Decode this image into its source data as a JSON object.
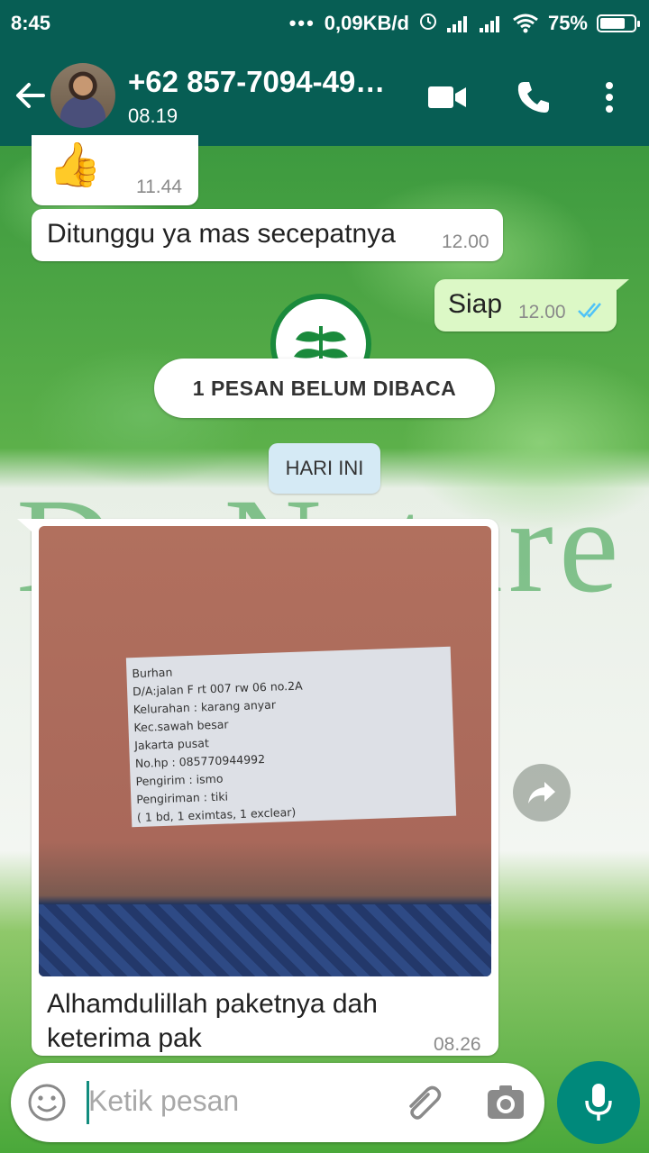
{
  "status_bar": {
    "time": "8:45",
    "dots": "•••",
    "network_speed": "0,09KB/d",
    "battery_percent": "75%",
    "battery_level": 0.75
  },
  "header": {
    "contact_name": "+62 857-7094-49…",
    "subtitle": "08.19"
  },
  "messages": [
    {
      "id": "thumbs",
      "direction": "in",
      "content": "👍",
      "time": "11.44"
    },
    {
      "id": "m1",
      "direction": "in",
      "text": "Ditunggu ya mas secepatnya",
      "time": "12.00"
    },
    {
      "id": "m2",
      "direction": "out",
      "text": "Siap",
      "time": "12.00",
      "status": "read"
    }
  ],
  "unread_banner": "1 PESAN BELUM DIBACA",
  "date_chip": "HARI INI",
  "photo_message": {
    "label_lines": [
      "Burhan",
      "D/A:jalan F rt 007 rw 06 no.2A",
      "Kelurahan : karang anyar",
      "Kec.sawah besar",
      "Jakarta pusat",
      "No.hp : 085770944992",
      "Pengirim : ismo",
      "Pengiriman : tiki",
      "( 1 bd, 1 eximtas, 1 exclear)"
    ],
    "caption_line1": "Alhamdulillah paketnya dah",
    "caption_line2": "keterima pak",
    "time": "08.26"
  },
  "background_text": "De Nature",
  "input": {
    "placeholder": "Ketik pesan"
  },
  "colors": {
    "header": "#075e54",
    "outgoing_bubble": "#dcf8c6",
    "read_ticks": "#4fc3f7",
    "mic_button": "#00897b"
  }
}
